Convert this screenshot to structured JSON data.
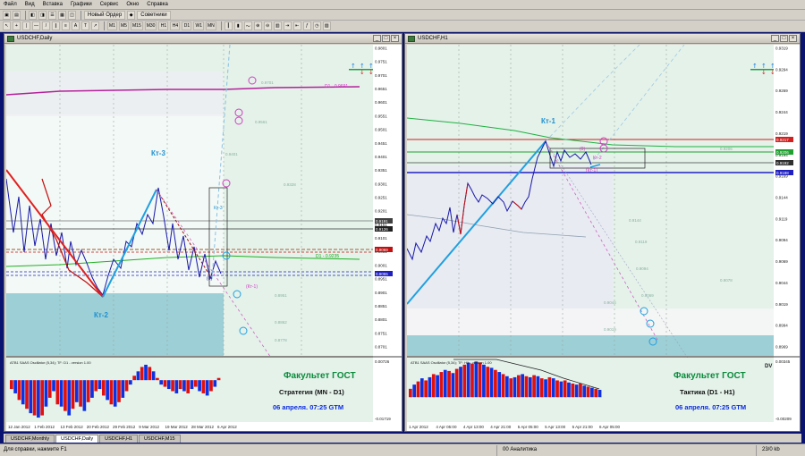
{
  "menu": [
    "Файл",
    "Вид",
    "Вставка",
    "Графики",
    "Сервис",
    "Окно",
    "Справка"
  ],
  "toolbar": {
    "new_order": "Новый Ордер",
    "advisors": "Советники",
    "periods": [
      "M1",
      "M5",
      "M15",
      "M30",
      "H1",
      "H4",
      "D1",
      "W1",
      "MN"
    ]
  },
  "left_window": {
    "title": "USDCHF,Daily",
    "labels": {
      "kt3": "Кт-3",
      "kt2": "Кт-2",
      "kt3_small": "Кт-3",
      "kt1_neg": "(Кт-1)",
      "d1": "D1 - 0.9691",
      "level": "D1 - 0.9235",
      "zero": "(0)"
    },
    "price_ticks": [
      "0.9801",
      "0.9751",
      "0.9701",
      "0.9651",
      "0.9601",
      "0.9551",
      "0.9501",
      "0.9451",
      "0.9401",
      "0.9351",
      "0.9301",
      "0.9251",
      "0.9201",
      "0.9151",
      "0.9101",
      "0.9051",
      "0.9001",
      "0.8951",
      "0.8901",
      "0.8851",
      "0.8801",
      "0.8751",
      "0.8701"
    ],
    "price_badges": [
      "0.9191",
      "0.9126",
      "0.9069",
      "0.9055"
    ],
    "date_ticks": [
      "12 Jan 2012",
      "1 Feb 2012",
      "13 Feb 2012",
      "20 Feb 2012",
      "29 Feb 2012",
      "9 Mar 2012",
      "19 Mar 2012",
      "28 Mar 2012",
      "6 Apr 2012"
    ],
    "osc_label": "ATB1 SAAS Oscillator (5,34); TF: D1 - version 1.00",
    "osc_ticks": [
      "0.00726",
      "-0.01719"
    ],
    "faculty": "Факультет ГОСТ",
    "strategy": "Стратегия (MN - D1)",
    "date": "06 апреля. 07:25 GTM",
    "osc_values": [
      -0.004,
      -0.006,
      -0.009,
      -0.011,
      -0.013,
      -0.015,
      -0.016,
      -0.017,
      -0.016,
      -0.012,
      -0.008,
      -0.005,
      -0.011,
      -0.012,
      -0.014,
      -0.016,
      -0.013,
      -0.01,
      -0.012,
      -0.014,
      -0.01,
      -0.008,
      -0.005,
      -0.004,
      -0.007,
      -0.009,
      -0.011,
      -0.012,
      -0.01,
      -0.008,
      -0.005,
      -0.002,
      0.002,
      0.004,
      0.006,
      0.007,
      0.006,
      0.004,
      0.001,
      -0.002,
      -0.003,
      -0.004,
      -0.005,
      -0.006,
      -0.004,
      -0.005,
      -0.006,
      -0.004,
      -0.003,
      -0.005,
      -0.006,
      -0.007,
      -0.005,
      -0.003,
      0.001
    ]
  },
  "right_window": {
    "title": "USDCHF,H1",
    "labels": {
      "kt1": "Кт-1",
      "kt1_neg": "(Кт-1)",
      "kt2_small": "Кт-2",
      "zero": "(0)",
      "dv": "DV"
    },
    "price_ticks": [
      "0.9319",
      "0.9294",
      "0.9269",
      "0.9244",
      "0.9219",
      "0.9194",
      "0.9169",
      "0.9144",
      "0.9119",
      "0.9094",
      "0.9069",
      "0.9044",
      "0.9019",
      "0.8994",
      "0.8969"
    ],
    "price_badges": [
      "0.9217",
      "0.9206",
      "0.9192",
      "0.9188"
    ],
    "date_ticks": [
      "1 Apr 2012",
      "4 Apr 05:00",
      "4 Apr 13:00",
      "4 Apr 21:00",
      "5 Apr 05:00",
      "5 Apr 13:00",
      "5 Apr 21:00",
      "6 Apr 05:00"
    ],
    "osc_label": "ATB1 SAAS Oscillator (5,34); TF: H1 - version 1.00",
    "osc_ticks": [
      "0.00345",
      "-0.00209"
    ],
    "faculty": "Факультет ГОСТ",
    "strategy": "Тактика (D1 - H1)",
    "date": "06 апреля. 07:25 GTM",
    "osc_values": [
      0.0008,
      0.0012,
      0.0015,
      0.0018,
      0.0016,
      0.0019,
      0.0022,
      0.0021,
      0.0024,
      0.0026,
      0.0025,
      0.0023,
      0.0027,
      0.0029,
      0.0031,
      0.0033,
      0.0032,
      0.0034,
      0.0033,
      0.0031,
      0.0029,
      0.0028,
      0.0026,
      0.0024,
      0.0022,
      0.002,
      0.0018,
      0.0019,
      0.0021,
      0.0022,
      0.002,
      0.0019,
      0.0021,
      0.002,
      0.0018,
      0.0017,
      0.0019,
      0.0018,
      0.0016,
      0.0015,
      0.0016,
      0.0014,
      0.0013,
      0.0012,
      0.0013,
      0.0011,
      0.001,
      0.0009,
      0.0008,
      0.0007
    ]
  },
  "tabs": [
    "USDCHF,Monthly",
    "USDCHF,Daily",
    "USDCHF,H1",
    "USDCHF,M15"
  ],
  "status": {
    "help": "Для справки, нажмите F1",
    "mid": "00 Аналитика",
    "traffic": "23/0 kb"
  },
  "colors": {
    "background": "#0a1470",
    "bars_red": "#e01010",
    "bars_blue": "#1030e0",
    "text_green": "#0a8a3a",
    "text_blue": "#0a2ae0",
    "chart_bg": "#e8f4ec"
  }
}
